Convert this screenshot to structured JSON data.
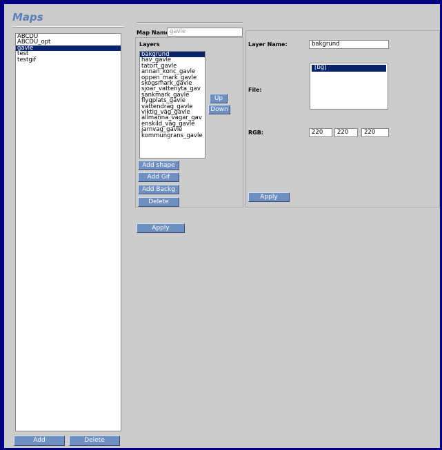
{
  "app_title": "Maps",
  "maps_list": [
    "ABCDU",
    "ABCDU_opt",
    "gavle",
    "test",
    "testgif"
  ],
  "maps_selected_index": 2,
  "left_buttons": {
    "add": "Add",
    "delete": "Delete"
  },
  "map_name": {
    "label": "Map Name",
    "value": "gavle"
  },
  "layers": {
    "label": "Layers",
    "items": [
      "bakgrund",
      "hav_gavle",
      "tatort_gavle",
      "annan_konc_gavle",
      "oppen_mark_gavle",
      "skogsmark_gavle",
      "sjoar_vattenyta_gav",
      "sankmark_gavle",
      "flygplats_gavle",
      "vattendrag_gavle",
      "viktig_väg_gavle",
      "allmanna_vagar_gav",
      "enskild_väg_gavle",
      "jarnvag_gavle",
      "kommungrans_gavle"
    ],
    "selected_index": 0,
    "up": "Up",
    "down": "Down",
    "add_shape": "Add shape",
    "add_gif": "Add Gif",
    "add_backg": "Add Backg",
    "delete": "Delete"
  },
  "apply_main": "Apply",
  "layer_props": {
    "layer_name_label": "Layer Name:",
    "layer_name_value": "bakgrund",
    "file_label": "File:",
    "file_items": [
      "[bg]"
    ],
    "rgb_label": "RGB:",
    "rgb": [
      "220",
      "220",
      "220"
    ],
    "apply": "Apply"
  }
}
